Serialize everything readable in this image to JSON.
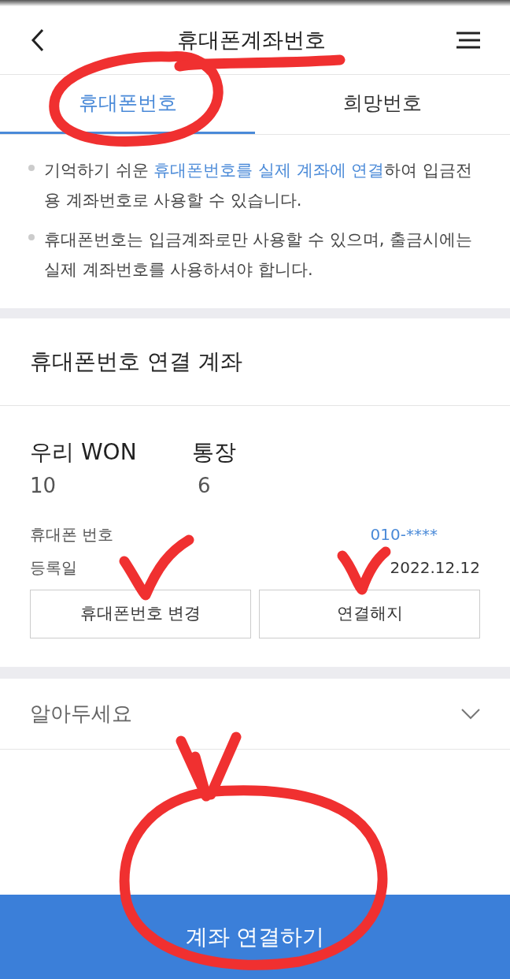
{
  "header": {
    "title": "휴대폰계좌번호"
  },
  "tabs": [
    {
      "label": "휴대폰번호",
      "selected": true
    },
    {
      "label": "희망번호",
      "selected": false
    }
  ],
  "notes": [
    [
      {
        "kind": "plain",
        "text": "기억하기 쉬운 "
      },
      {
        "kind": "link",
        "text": "휴대폰번호를 실제 계좌에 연결"
      },
      {
        "kind": "plain",
        "text": "하여 입금전용 계좌번호로 사용할 수 있습니다."
      }
    ],
    [
      {
        "kind": "plain",
        "text": "휴대폰번호는 입금계좌로만 사용할 수 있으며, 출금시에는 실제 계좌번호를 사용하셔야 합니다."
      }
    ]
  ],
  "section_title": "휴대폰번호 연결 계좌",
  "account": {
    "name_parts": [
      "우리 WON",
      "통장"
    ],
    "number_parts": [
      "10",
      "6"
    ],
    "details": [
      {
        "label": "휴대폰 번호",
        "value": "010-****",
        "kind": "link"
      },
      {
        "label": "등록일",
        "value": "2022.12.12",
        "kind": "plain"
      }
    ],
    "buttons": [
      "휴대폰번호 변경",
      "연결해지"
    ]
  },
  "notice": {
    "label": "알아두세요",
    "expanded": false
  },
  "primary_button": "계좌 연결하기"
}
